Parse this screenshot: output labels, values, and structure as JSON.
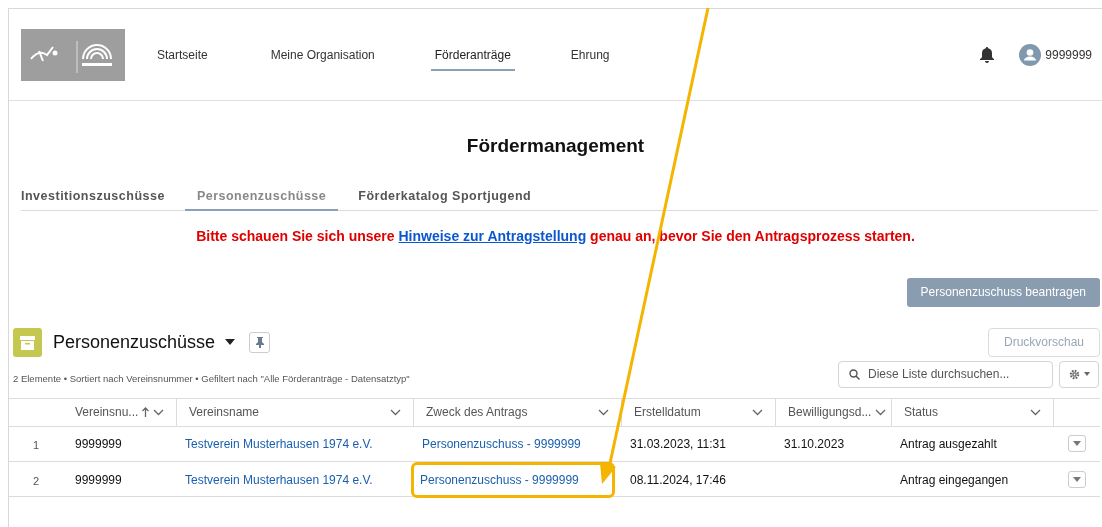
{
  "nav": {
    "items": [
      {
        "label": "Startseite",
        "selected": false
      },
      {
        "label": "Meine Organisation",
        "selected": false
      },
      {
        "label": "Förderanträge",
        "selected": true
      },
      {
        "label": "Ehrung",
        "selected": false
      }
    ],
    "user": "9999999"
  },
  "page_title": "Fördermanagement",
  "tabs": [
    {
      "label": "Investitionszuschüsse",
      "selected": false
    },
    {
      "label": "Personenzuschüsse",
      "selected": true
    },
    {
      "label": "Förderkatalog Sportjugend",
      "selected": false
    }
  ],
  "notice": {
    "before": "Bitte schauen Sie sich unsere ",
    "link": "Hinweise zur Antragstellung",
    "after": " genau an, bevor Sie den Antragsprozess starten."
  },
  "apply_button": "Personenzuschuss beantragen",
  "list": {
    "title": "Personenzuschüsse",
    "print_button": "Druckvorschau",
    "search_placeholder": "Diese Liste durchsuchen...",
    "info": "2 Elemente • Sortiert nach Vereinsnummer • Gefiltert nach \"Alle Förderanträge - Datensatztyp\"",
    "columns": [
      {
        "label": "Vereinsnu...",
        "sorted": true
      },
      {
        "label": "Vereinsname",
        "sorted": false
      },
      {
        "label": "Zweck des Antrags",
        "sorted": false
      },
      {
        "label": "Erstelldatum",
        "sorted": false
      },
      {
        "label": "Bewilligungsd...",
        "sorted": false
      },
      {
        "label": "Status",
        "sorted": false
      }
    ],
    "rows": [
      {
        "number": "1",
        "cells": [
          "9999999",
          "Testverein Musterhausen 1974 e.V.",
          "Personenzuschuss - 9999999",
          "31.03.2023, 11:31",
          "31.10.2023",
          "Antrag ausgezahlt"
        ],
        "highlighted": false
      },
      {
        "number": "2",
        "cells": [
          "9999999",
          "Testverein Musterhausen 1974 e.V.",
          "Personenzuschuss - 9999999",
          "08.11.2024, 17:46",
          "",
          "Antrag eingegangen"
        ],
        "highlighted": true
      }
    ]
  }
}
